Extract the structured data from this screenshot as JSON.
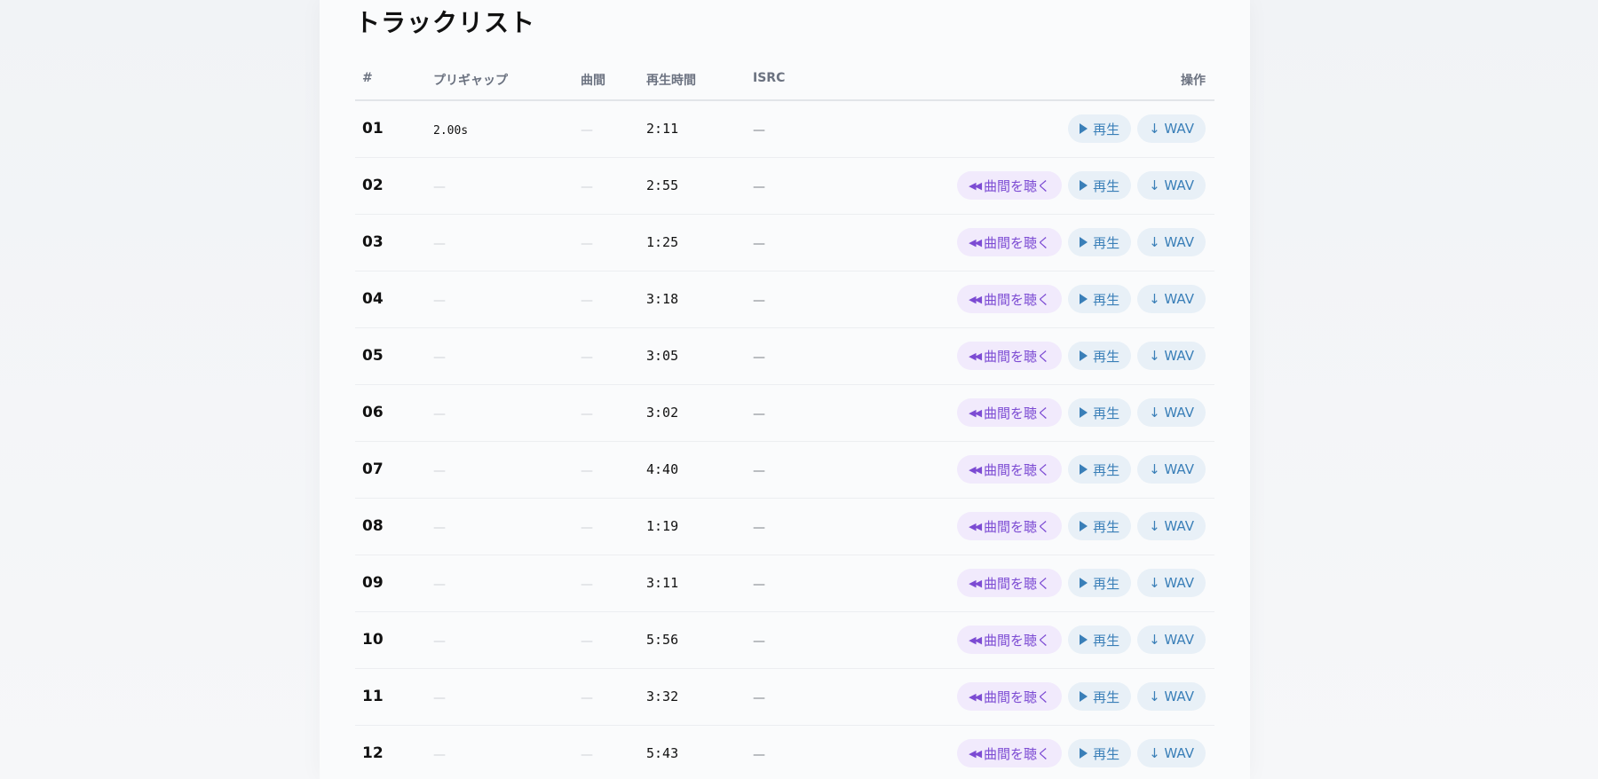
{
  "section": {
    "title": "トラックリスト"
  },
  "table": {
    "headers": {
      "num": "#",
      "pregap": "プリギャップ",
      "gap": "曲間",
      "duration": "再生時間",
      "isrc": "ISRC",
      "actions": "操作"
    },
    "dash": "—",
    "buttons": {
      "gap_label": "曲間を聴く",
      "play_label": "再生",
      "wav_label": "↓ WAV"
    },
    "rows": [
      {
        "num": "01",
        "pregap": "2.00s",
        "gap": "—",
        "duration": "2:11",
        "isrc": "—"
      },
      {
        "num": "02",
        "pregap": "—",
        "gap": "—",
        "duration": "2:55",
        "isrc": "—"
      },
      {
        "num": "03",
        "pregap": "—",
        "gap": "—",
        "duration": "1:25",
        "isrc": "—"
      },
      {
        "num": "04",
        "pregap": "—",
        "gap": "—",
        "duration": "3:18",
        "isrc": "—"
      },
      {
        "num": "05",
        "pregap": "—",
        "gap": "—",
        "duration": "3:05",
        "isrc": "—"
      },
      {
        "num": "06",
        "pregap": "—",
        "gap": "—",
        "duration": "3:02",
        "isrc": "—"
      },
      {
        "num": "07",
        "pregap": "—",
        "gap": "—",
        "duration": "4:40",
        "isrc": "—"
      },
      {
        "num": "08",
        "pregap": "—",
        "gap": "—",
        "duration": "1:19",
        "isrc": "—"
      },
      {
        "num": "09",
        "pregap": "—",
        "gap": "—",
        "duration": "3:11",
        "isrc": "—"
      },
      {
        "num": "10",
        "pregap": "—",
        "gap": "—",
        "duration": "5:56",
        "isrc": "—"
      },
      {
        "num": "11",
        "pregap": "—",
        "gap": "—",
        "duration": "3:32",
        "isrc": "—"
      },
      {
        "num": "12",
        "pregap": "—",
        "gap": "—",
        "duration": "5:43",
        "isrc": "—"
      }
    ]
  },
  "icons": {
    "gap": "skip-previous-icon",
    "play": "play-icon"
  },
  "colors": {
    "gap_button_bg": "#f1eafc",
    "gap_button_text": "#7c4bd3",
    "play_button_bg": "#e8f0f7",
    "play_button_text": "#3a7fb8"
  }
}
